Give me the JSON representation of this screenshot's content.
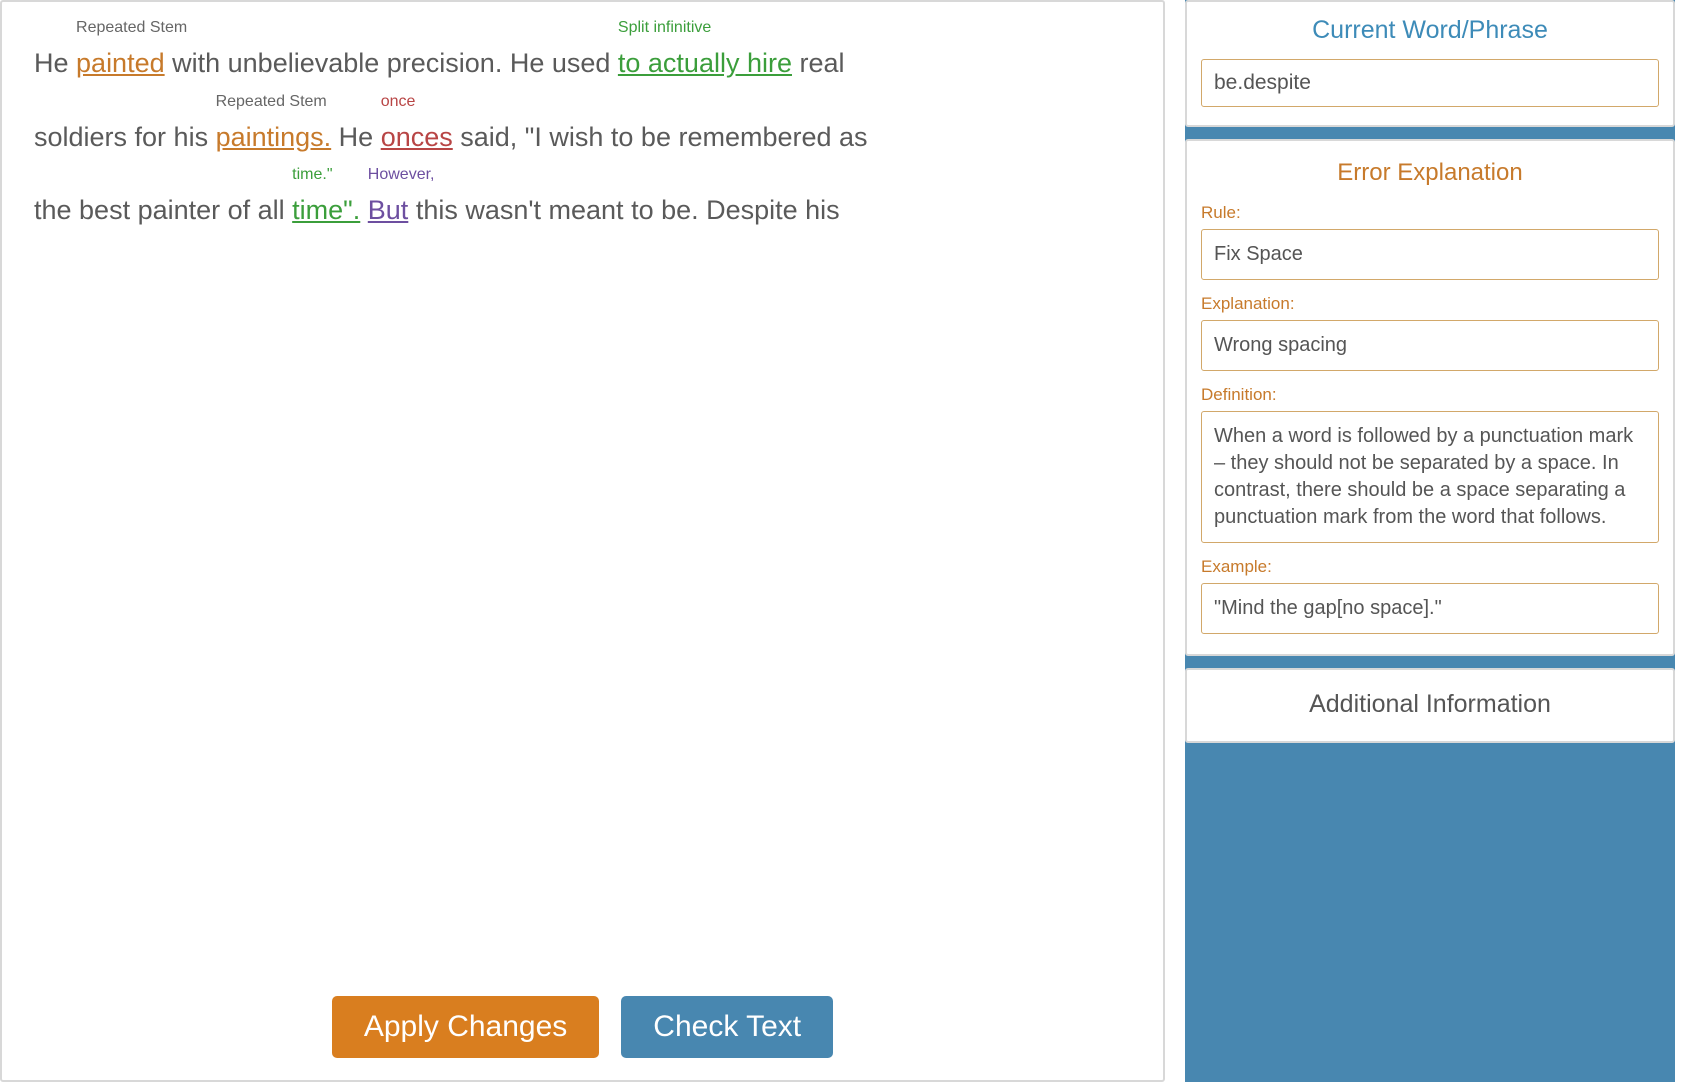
{
  "editor": {
    "line1": {
      "pre1": "He ",
      "w1": "painted",
      "w1_annot": "Repeated Stem",
      "mid1": " with unbelievable precision. He used ",
      "w2": "to actually hire",
      "w2_annot": "Split infinitive",
      "post1": " real"
    },
    "line2": {
      "pre1": "soldiers for his ",
      "w1": "paintings.",
      "w1_annot": "Repeated Stem",
      "mid1": " He ",
      "w2": "onces",
      "w2_annot": "once",
      "post1": " said, \"I wish to be remembered as"
    },
    "line3": {
      "pre1": "the best painter of all ",
      "w1": "time\".",
      "w1_annot": "time.\"",
      "mid1": " ",
      "w2": "But",
      "w2_annot": "However,",
      "post1": " this wasn't meant to be. Despite his"
    },
    "buttons": {
      "apply": "Apply Changes",
      "check": "Check Text"
    }
  },
  "sidebar": {
    "current": {
      "title": "Current Word/Phrase",
      "value": "be.despite"
    },
    "error": {
      "title": "Error Explanation",
      "rule_label": "Rule:",
      "rule_value": "Fix Space",
      "explanation_label": "Explanation:",
      "explanation_value": "Wrong spacing",
      "definition_label": "Definition:",
      "definition_value": "When a word is followed by a punctuation mark – they should not be separated by a space. In contrast, there should be a space separating a punctuation mark from the word that follows.",
      "example_label": "Example:",
      "example_value": "\"Mind the gap[no space].\""
    },
    "additional": {
      "title": "Additional Information"
    }
  }
}
